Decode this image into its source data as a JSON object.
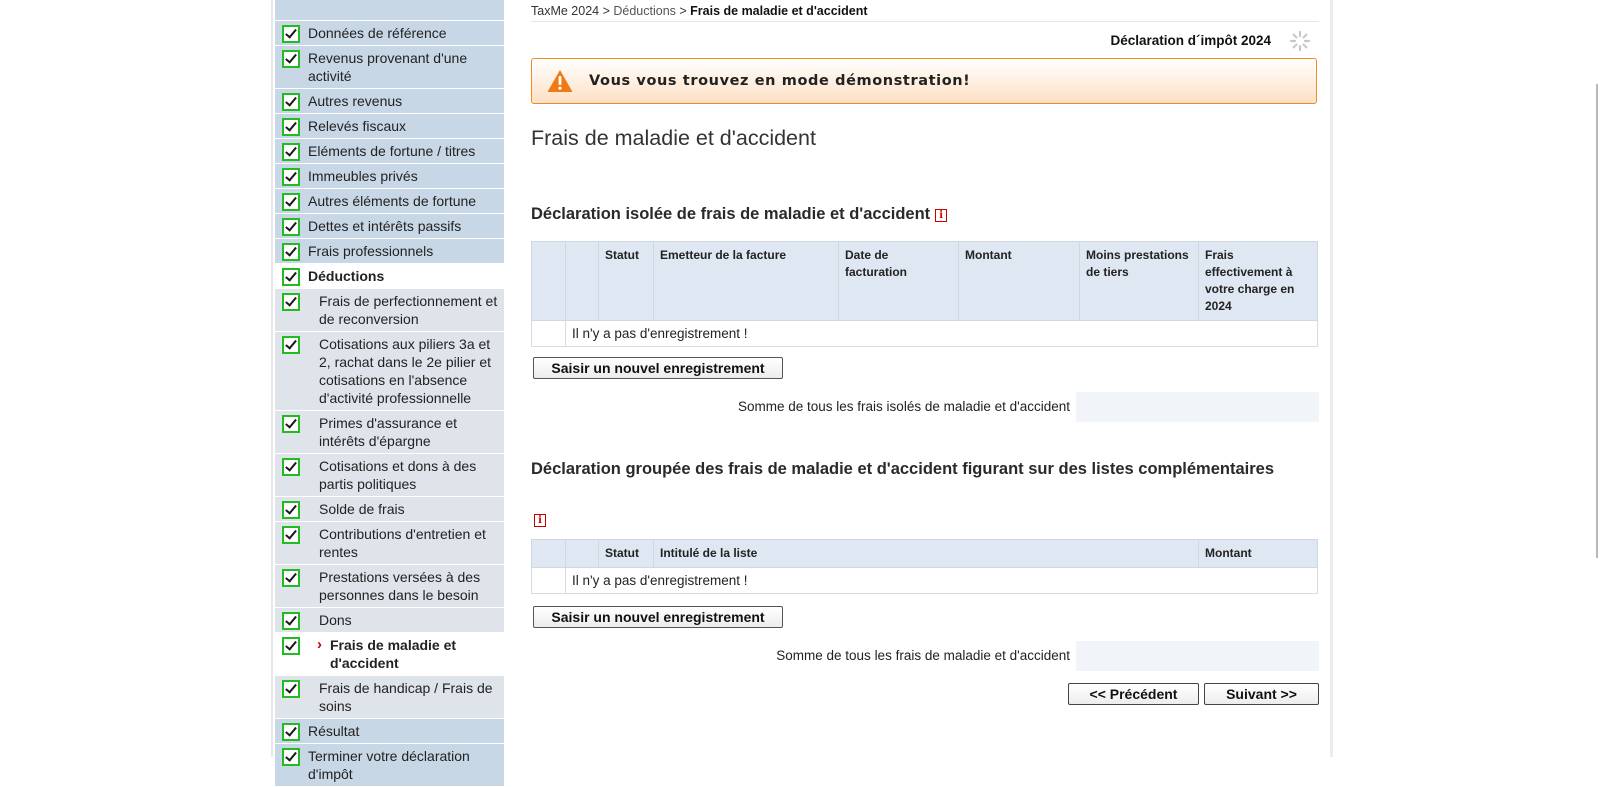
{
  "sidebar": {
    "items": [
      {
        "label": "Données de référence"
      },
      {
        "label": "Revenus provenant d'une activité"
      },
      {
        "label": "Autres revenus"
      },
      {
        "label": "Relevés fiscaux"
      },
      {
        "label": "Eléments de fortune / titres"
      },
      {
        "label": "Immeubles privés"
      },
      {
        "label": "Autres éléments de fortune"
      },
      {
        "label": "Dettes et intérêts passifs"
      },
      {
        "label": "Frais professionnels"
      },
      {
        "label": "Déductions"
      },
      {
        "label": "Frais de perfectionnement et de reconversion"
      },
      {
        "label": "Cotisations aux piliers 3a et 2, rachat dans le 2e pilier et cotisations en l'absence d'activité professionnelle"
      },
      {
        "label": "Primes d'assurance et intérêts d'épargne"
      },
      {
        "label": "Cotisations et dons à des partis politiques"
      },
      {
        "label": "Solde de frais"
      },
      {
        "label": "Contributions d'entretien et rentes"
      },
      {
        "label": "Prestations versées à des personnes dans le besoin"
      },
      {
        "label": "Dons"
      },
      {
        "label": "Frais de maladie et d'accident"
      },
      {
        "label": "Frais de handicap / Frais de soins"
      },
      {
        "label": "Résultat"
      },
      {
        "label": "Terminer votre déclaration d'impôt"
      }
    ]
  },
  "breadcrumb": {
    "root": "TaxMe 2024",
    "sep1": " > ",
    "mid": "Déductions",
    "sep2": " > ",
    "current": "Frais de maladie et d'accident"
  },
  "header": {
    "declaration_title": "Déclaration d´impôt 2024"
  },
  "demo_banner": {
    "text": "Vous vous trouvez en mode démonstration!",
    "color": "#f08a2c"
  },
  "page_title": "Frais de maladie et d'accident",
  "section1": {
    "title": "Déclaration isolée de frais de maladie et d'accident",
    "columns": [
      "Statut",
      "Emetteur de la facture",
      "Date de facturation",
      "Montant",
      "Moins prestations de tiers",
      "Frais effectivement à votre charge en 2024"
    ],
    "empty_text": "Il n'y a pas d'enregistrement !",
    "new_button": "Saisir un nouvel enregistrement",
    "sum_label": "Somme de tous les frais isolés de maladie et d'accident"
  },
  "section2": {
    "title": "Déclaration groupée des frais de maladie et d'accident figurant sur des listes complémentaires",
    "columns": [
      "Statut",
      "Intitulé de la liste",
      "Montant"
    ],
    "empty_text": "Il n'y a pas d'enregistrement !",
    "new_button": "Saisir un nouvel enregistrement",
    "sum_label": "Somme de tous les frais de maladie et d'accident"
  },
  "nav": {
    "prev": "<< Précédent",
    "next": "Suivant >>"
  },
  "icons": {
    "info": "info-icon",
    "warning": "warning-icon",
    "check": "check-icon",
    "spinner": "spinner-icon"
  },
  "colors": {
    "check_border": "#22bb22",
    "sidebar_bg": "#c8d7e5",
    "table_header": "#dfe8f2",
    "info": "#cc0000"
  }
}
